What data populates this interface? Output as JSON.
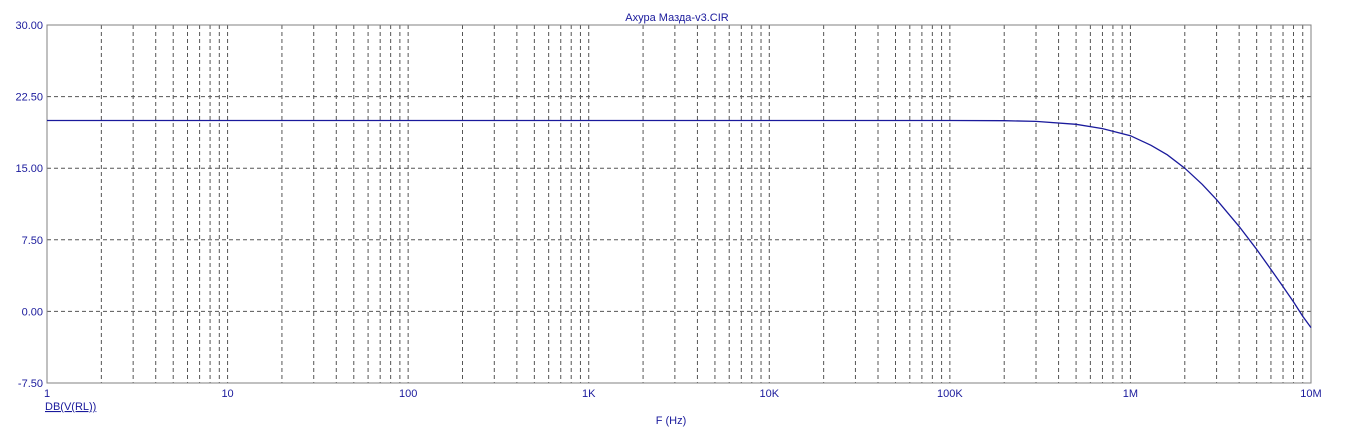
{
  "chart_data": {
    "type": "line",
    "title": "Ахура Мазда-v3.CIR",
    "xlabel": "F (Hz)",
    "ylabel": "",
    "x_scale": "log",
    "xlim": [
      1,
      10000000
    ],
    "ylim": [
      -7.5,
      30
    ],
    "grid": true,
    "x_tick_values": [
      1,
      10,
      100,
      1000,
      10000,
      100000,
      1000000,
      10000000
    ],
    "x_tick_labels": [
      "1",
      "10",
      "100",
      "1K",
      "10K",
      "100K",
      "1M",
      "10M"
    ],
    "y_tick_values": [
      -7.5,
      0,
      7.5,
      15,
      22.5,
      30
    ],
    "y_tick_labels": [
      "-7.50",
      "0.00",
      "7.50",
      "15.00",
      "22.50",
      "30.00"
    ],
    "series": [
      {
        "name": "DB(V(RL))",
        "color": "#1a1a9c",
        "x": [
          1,
          10,
          100,
          1000,
          10000,
          100000,
          200000,
          300000,
          500000,
          700000,
          1000000,
          1300000,
          1600000,
          2000000,
          2500000,
          3000000,
          4000000,
          5000000,
          6000000,
          7000000,
          8000000,
          9000000,
          10000000
        ],
        "y": [
          20,
          20,
          20,
          20,
          20,
          20,
          19.98,
          19.9,
          19.6,
          19.15,
          18.4,
          17.4,
          16.4,
          15.0,
          13.3,
          11.7,
          8.9,
          6.5,
          4.4,
          2.6,
          1.0,
          -0.5,
          -1.7
        ]
      }
    ]
  }
}
